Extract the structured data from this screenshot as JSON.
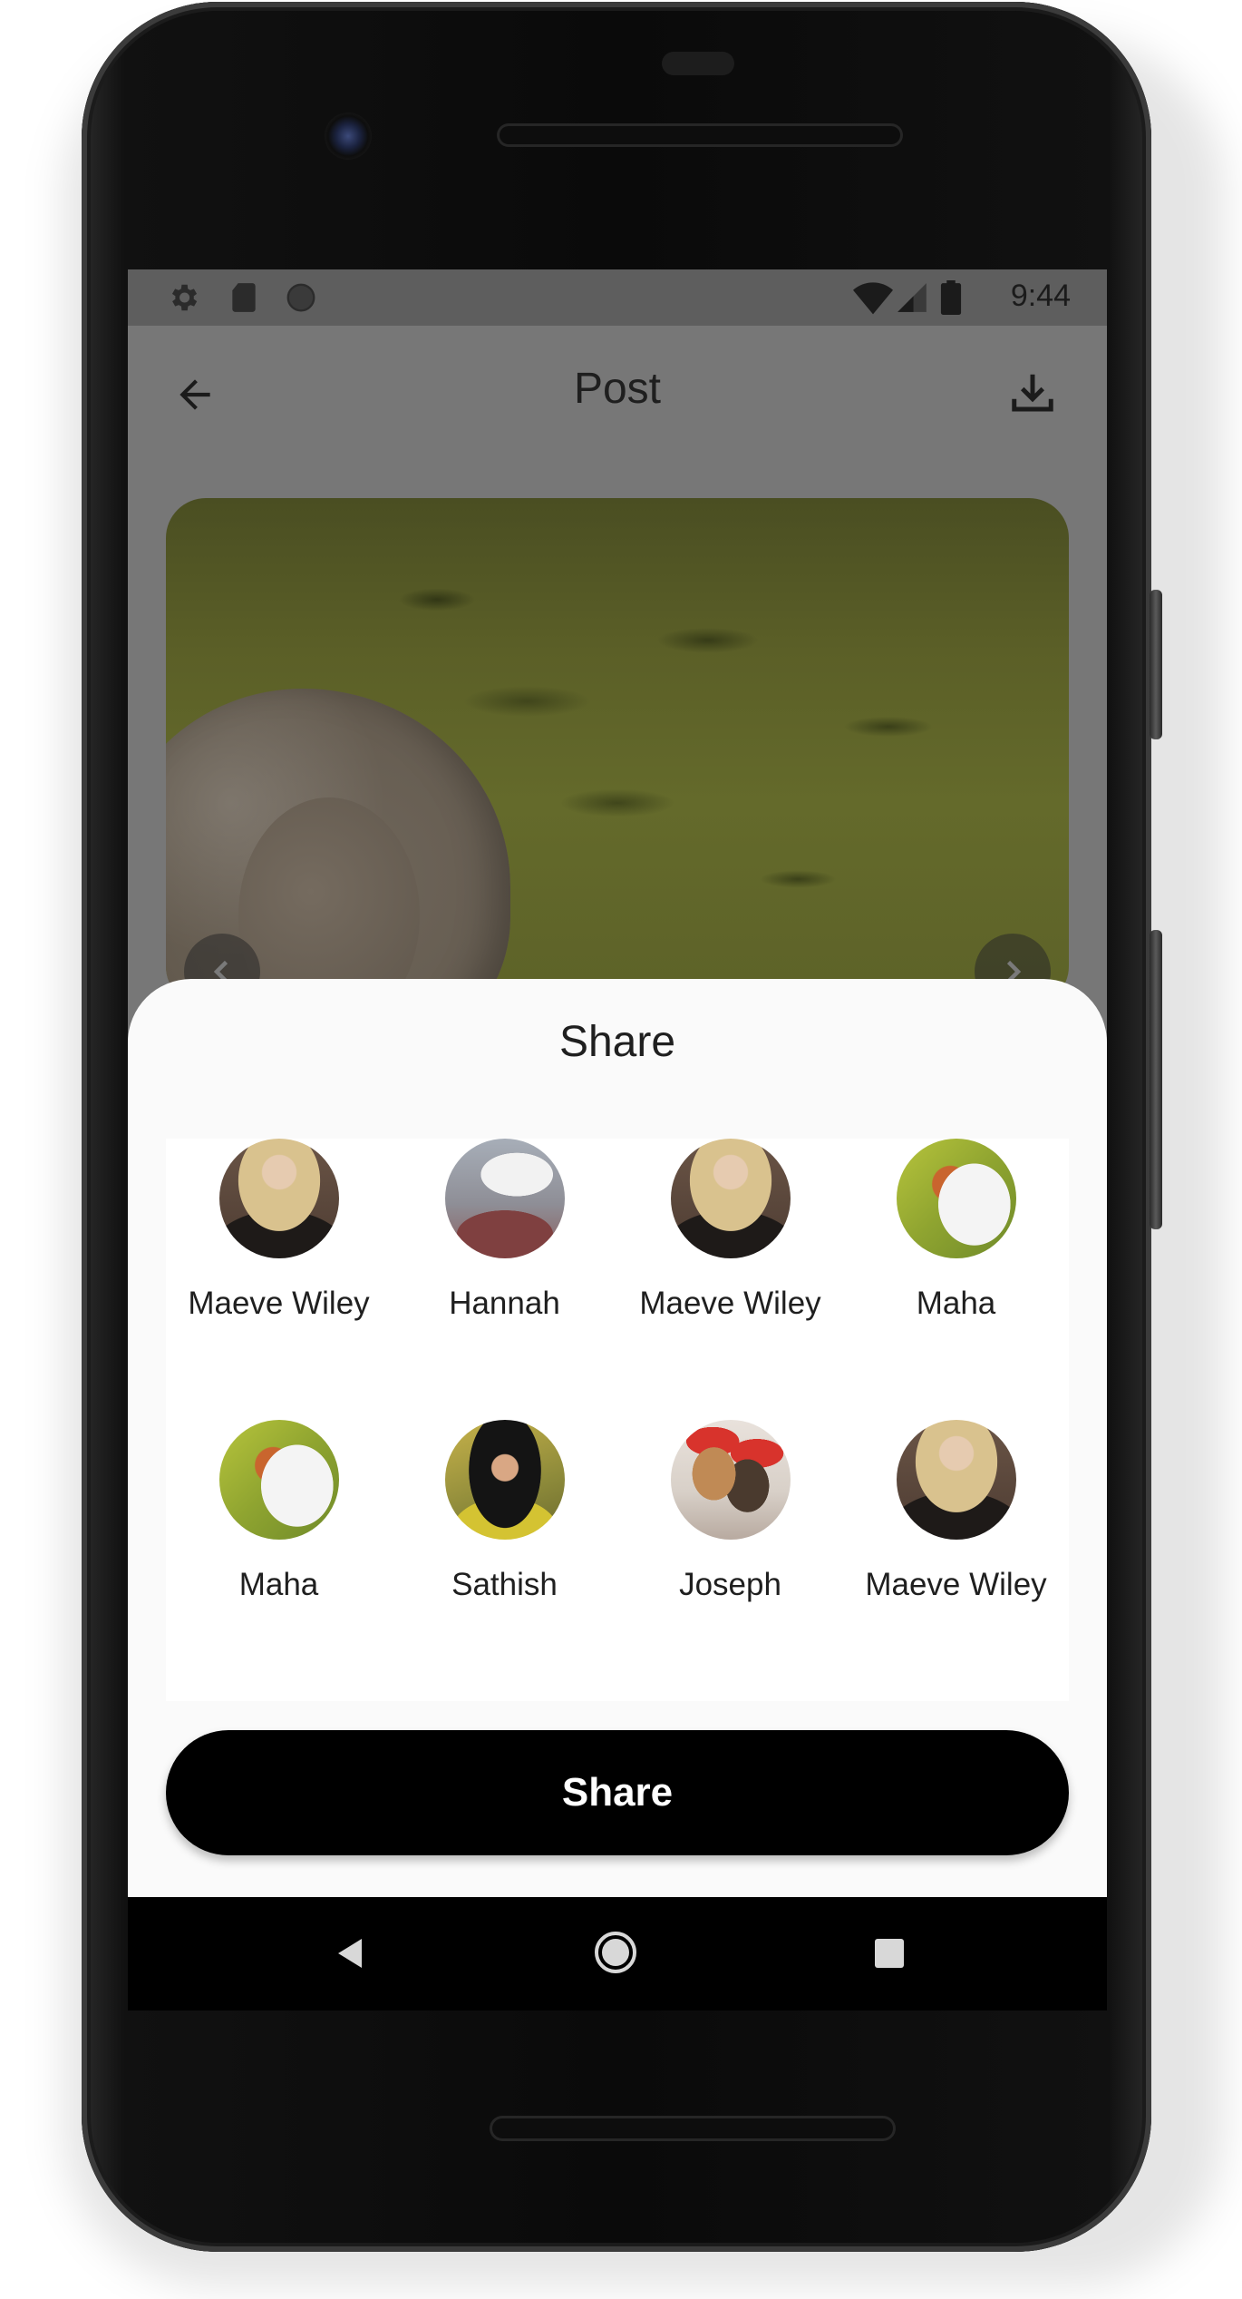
{
  "status_bar": {
    "time": "9:44",
    "icons": [
      "gear-icon",
      "sd-card-icon",
      "circle-icon",
      "wifi-icon",
      "signal-icon",
      "battery-icon"
    ]
  },
  "app_bar": {
    "title": "Post",
    "back_icon": "arrow-left-icon",
    "action_icon": "download-icon"
  },
  "post": {
    "prev_icon": "chevron-left-icon",
    "next_icon": "chevron-right-icon"
  },
  "share_sheet": {
    "title": "Share",
    "contacts": [
      {
        "name": "Maeve Wiley"
      },
      {
        "name": "Hannah"
      },
      {
        "name": "Maeve Wiley"
      },
      {
        "name": "Maha"
      },
      {
        "name": "Maha"
      },
      {
        "name": "Sathish"
      },
      {
        "name": "Joseph"
      },
      {
        "name": "Maeve Wiley"
      }
    ],
    "button_label": "Share"
  },
  "nav_bar": {
    "back_icon": "triangle-back-icon",
    "home_icon": "circle-home-icon",
    "recents_icon": "square-recents-icon"
  },
  "colors": {
    "scrim": "#777777",
    "sheet_background": "#fafafa",
    "button_background": "#000000",
    "button_text": "#ffffff"
  }
}
